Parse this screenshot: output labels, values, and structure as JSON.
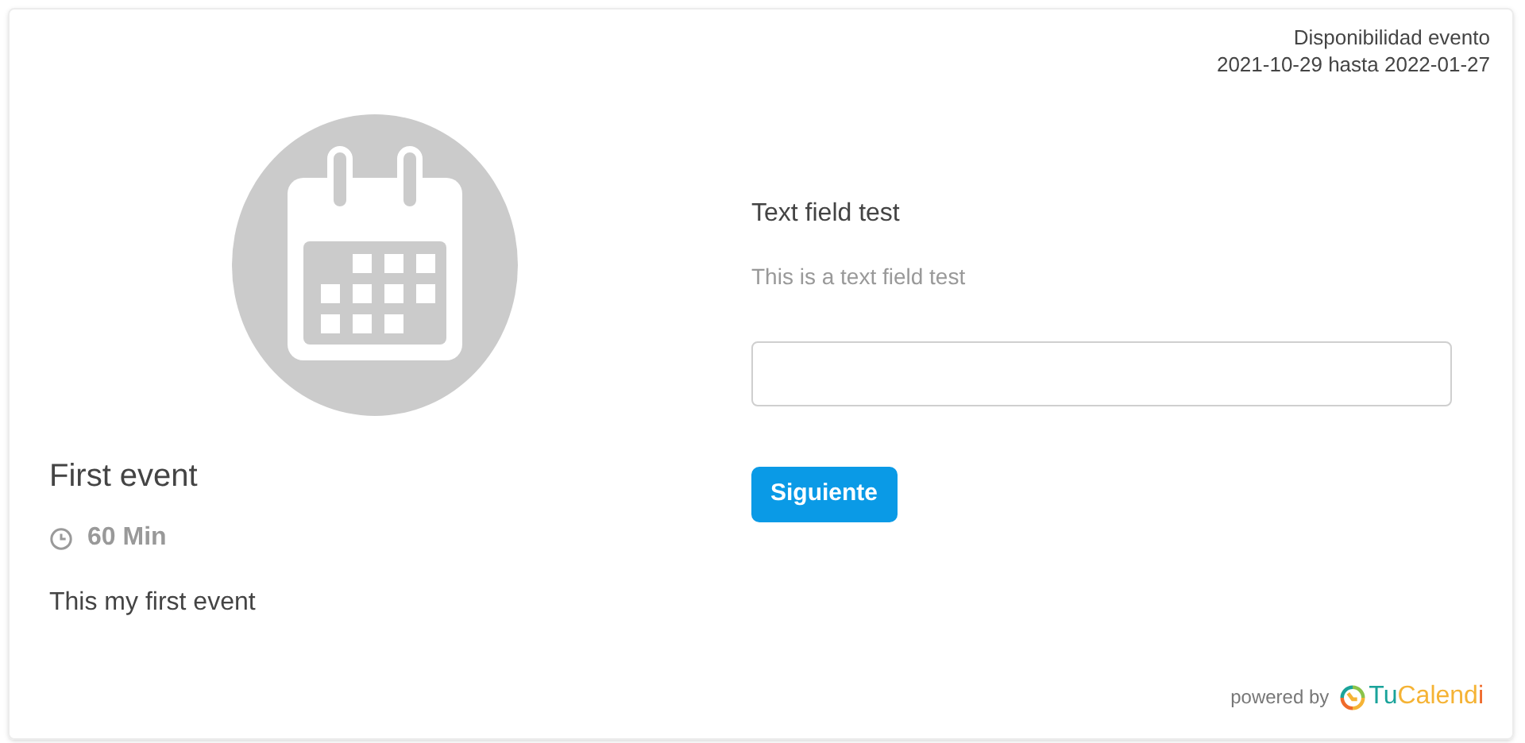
{
  "availability": {
    "label": "Disponibilidad evento",
    "range": "2021-10-29 hasta 2022-01-27"
  },
  "event": {
    "title": "First event",
    "duration": "60 Min",
    "description": "This my first event"
  },
  "form": {
    "question": "Text field test",
    "help": "This is a text field test",
    "button": "Siguiente"
  },
  "footer": {
    "powered_by": "powered by",
    "brand": [
      {
        "text": "Tu",
        "color": "#1aa39a"
      },
      {
        "text": "Calend",
        "color": "#f5b335"
      },
      {
        "text": "i",
        "color": "#ef6a2b"
      }
    ]
  }
}
